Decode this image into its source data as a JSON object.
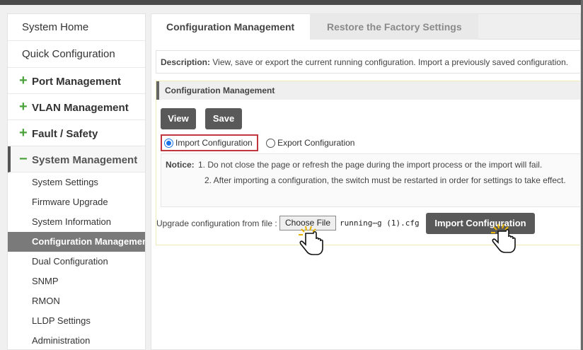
{
  "sidebar": {
    "home": "System Home",
    "quick": "Quick Configuration",
    "groups": [
      {
        "icon": "+",
        "label": "Port Management"
      },
      {
        "icon": "+",
        "label": "VLAN Management"
      },
      {
        "icon": "+",
        "label": "Fault / Safety"
      }
    ],
    "open_group": {
      "icon": "−",
      "label": "System Management"
    },
    "sub_items": [
      "System Settings",
      "Firmware Upgrade",
      "System Information",
      "Configuration Management",
      "Dual Configuration",
      "SNMP",
      "RMON",
      "LLDP Settings",
      "Administration"
    ]
  },
  "tabs": {
    "active": "Configuration Management",
    "inactive": "Restore the Factory Settings"
  },
  "description": {
    "label": "Description:",
    "text": "View, save or export the current running configuration. Import a previously saved configuration."
  },
  "panel": {
    "title": "Configuration Management",
    "view_label": "View",
    "save_label": "Save",
    "import_option": "Import Configuration",
    "export_option": "Export Configuration",
    "notice_label": "Notice:",
    "notice_1": "1. Do not close the page or refresh the page during the import process or the import will fail.",
    "notice_2": "2. After importing a configuration, the switch must be restarted in order for settings to take effect.",
    "upgrade_label": "Upgrade configuration from file :",
    "choose_file_label": "Choose File",
    "file_name": "running⋯g (1).cfg",
    "import_button_label": "Import Configuration"
  },
  "colors": {
    "accent_green": "#4aa33a",
    "button_dark": "#595959",
    "highlight_red": "#c0373f"
  }
}
